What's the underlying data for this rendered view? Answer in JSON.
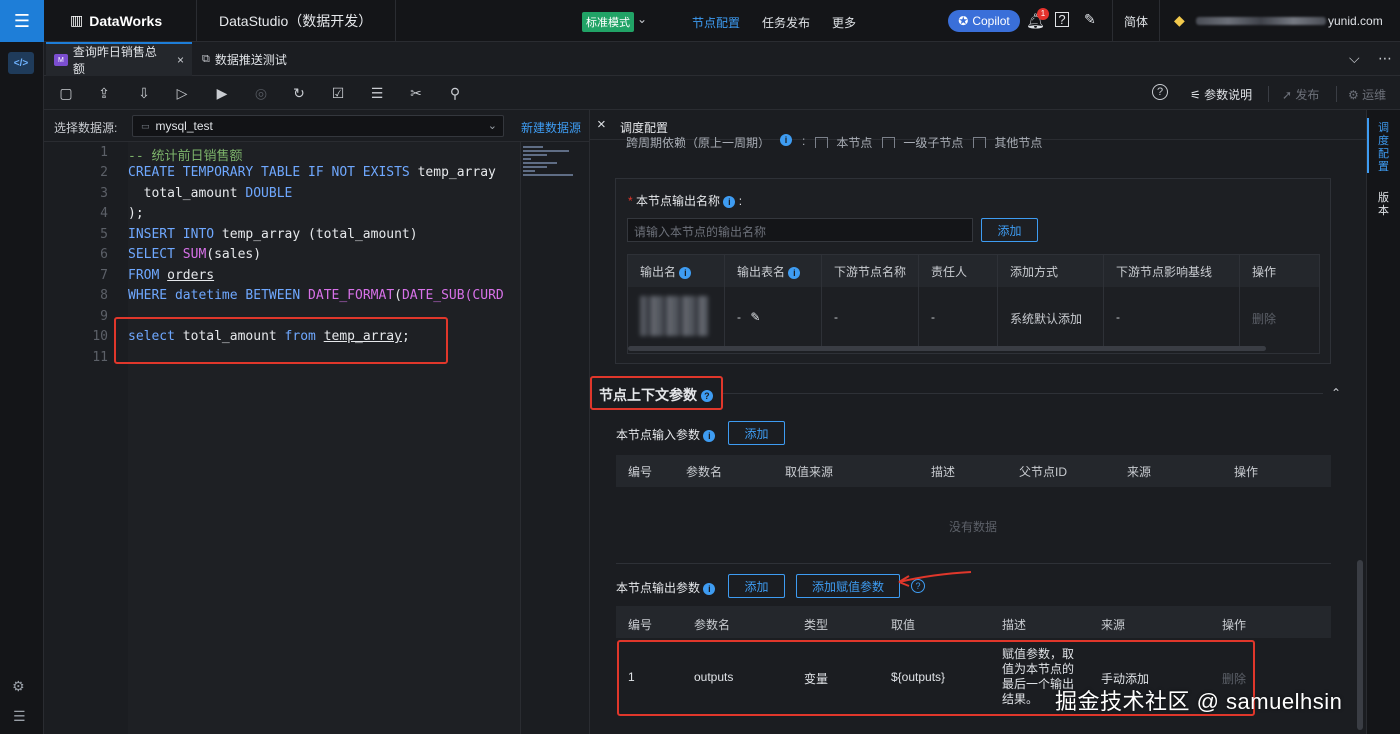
{
  "topbar": {
    "brand": "DataWorks",
    "studio": "DataStudio（数据开发）",
    "mode": "标准模式",
    "nav": [
      "节点配置",
      "任务发布",
      "更多"
    ],
    "copilot": "Copilot",
    "bell_count": "1",
    "help": "?",
    "language": "简体",
    "account_suffix": "yunid.com"
  },
  "tabs": [
    {
      "label": "查询昨日销售总额",
      "icon": "sql-file-icon",
      "close": "×"
    },
    {
      "label": "数据推送测试",
      "icon": "workflow-icon"
    }
  ],
  "toolbar": {
    "params_label": "参数说明",
    "publish_label": "发布",
    "ops_label": "运维"
  },
  "datasource": {
    "label": "选择数据源:",
    "value": "mysql_test",
    "new_link": "新建数据源"
  },
  "editor": {
    "line_numbers": [
      "1",
      "2",
      "3",
      "4",
      "5",
      "6",
      "7",
      "8",
      "9",
      "10",
      "11"
    ],
    "lines": {
      "l1": "-- 统计前日销售额",
      "l2a": "CREATE TEMPORARY TABLE IF NOT EXISTS ",
      "l2b": "temp_array",
      "l3a": "  total_amount ",
      "l3b": "DOUBLE",
      "l4": ");",
      "l5a": "INSERT INTO ",
      "l5b": "temp_array (total_amount)",
      "l6a": "SELECT ",
      "l6b": "SUM",
      "l6c": "(sales)",
      "l7a": "FROM ",
      "l7b": "orders",
      "l8a": "WHERE ",
      "l8b": "datetime ",
      "l8c": "BETWEEN ",
      "l8d": "DATE_FORMAT",
      "l8e": "(",
      "l8f": "DATE_SUB",
      "l8g": "(CURD",
      "l10a": "select ",
      "l10b": "total_amount ",
      "l10c": "from ",
      "l10d": "temp_array",
      "l10e": ";"
    }
  },
  "panel": {
    "title": "调度配置",
    "close": "×",
    "cycle_label": "跨周期依赖（原上一周期）",
    "cycle_options": [
      "本节点",
      "一级子节点",
      "其他节点"
    ],
    "output_name_label": "本节点输出名称",
    "output_name_placeholder": "请输入本节点的输出名称",
    "add": "添加",
    "output_table": {
      "headers": [
        "输出名",
        "输出表名",
        "下游节点名称",
        "责任人",
        "添加方式",
        "下游节点影响基线",
        "操作"
      ],
      "row": {
        "table_name": "-",
        "downstream": "-",
        "owner": "-",
        "add_method": "系统默认添加",
        "baseline": "-",
        "action": "删除"
      }
    },
    "context_title": "节点上下文参数",
    "input_params_label": "本节点输入参数",
    "input_headers": [
      "编号",
      "参数名",
      "取值来源",
      "描述",
      "父节点ID",
      "来源",
      "操作"
    ],
    "no_data": "没有数据",
    "output_params_label": "本节点输出参数",
    "add_assign": "添加赋值参数",
    "output_headers": [
      "编号",
      "参数名",
      "类型",
      "取值",
      "描述",
      "来源",
      "操作"
    ],
    "output_row": {
      "no": "1",
      "name": "outputs",
      "type": "变量",
      "value": "${outputs}",
      "desc": "赋值参数，取值为本节点的最后一个输出结果。",
      "source": "手动添加",
      "action": "删除"
    }
  },
  "right_rail": {
    "schedule": "调度配置",
    "version": "版本"
  },
  "watermark": "掘金技术社区 @ samuelhsin",
  "colors": {
    "accent": "#3e9cf2",
    "highlight": "#e0372b",
    "mode_badge": "#21a366"
  }
}
